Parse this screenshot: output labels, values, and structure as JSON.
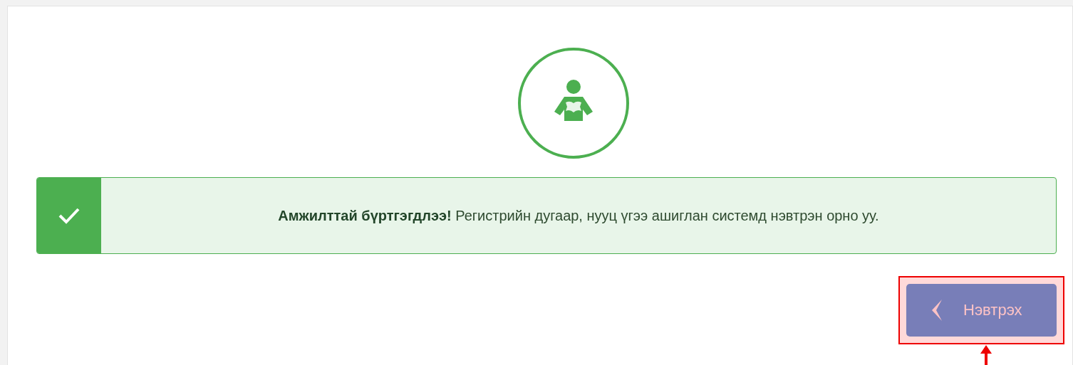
{
  "alert": {
    "message": "**Амжилттай бүртгэгдлээ!** Регистрийн дугаар, нууц үгээ ашиглан системд нэвтрэн орно уу."
  },
  "login_button": {
    "label": "Нэвтрэх"
  }
}
